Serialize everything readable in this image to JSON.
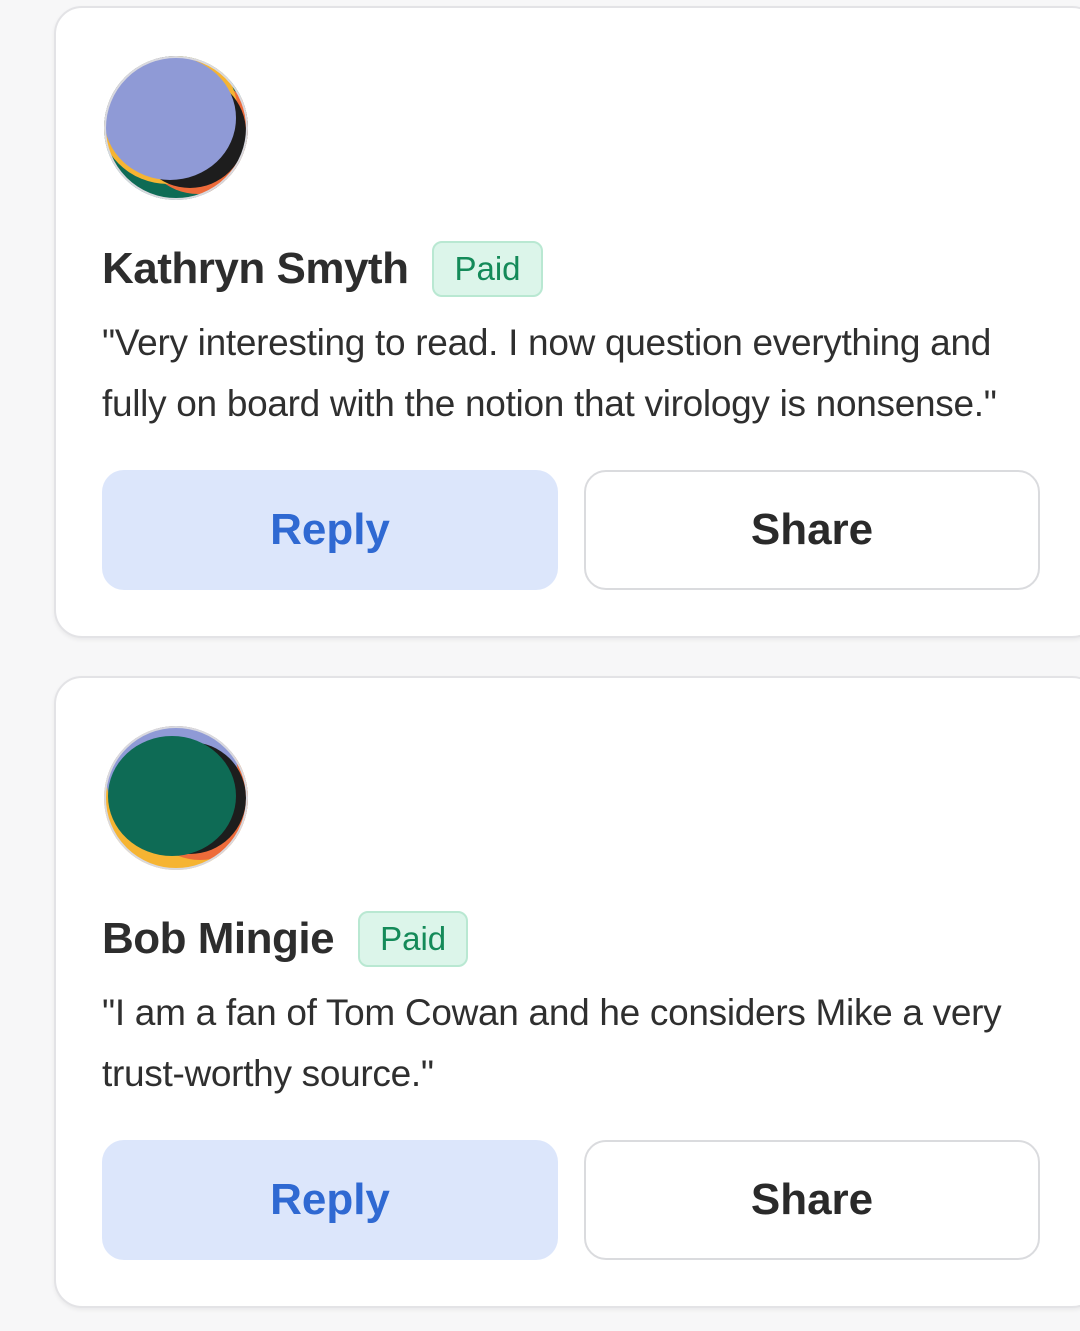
{
  "comments": [
    {
      "author": "Kathryn Smyth",
      "badge": "Paid",
      "text": "\"Very interesting to read. I now question everything and fully on board with the notion that virology is nonsense.\"",
      "reply_label": "Reply",
      "share_label": "Share",
      "avatar_colors": [
        "#8f9ad6",
        "#0e6b55",
        "#f6b432",
        "#ee6b3a"
      ]
    },
    {
      "author": "Bob Mingie",
      "badge": "Paid",
      "text": "\"I am a fan of Tom Cowan and he considers Mike a very trust-worthy source.\"",
      "reply_label": "Reply",
      "share_label": "Share",
      "avatar_colors": [
        "#0e6b55",
        "#8f9ad6",
        "#f6b432",
        "#ee6b3a"
      ]
    }
  ],
  "colors": {
    "reply_bg": "#dce6fb",
    "reply_text": "#2f69d2",
    "badge_bg": "#dcf5ea",
    "badge_text": "#148a59"
  }
}
